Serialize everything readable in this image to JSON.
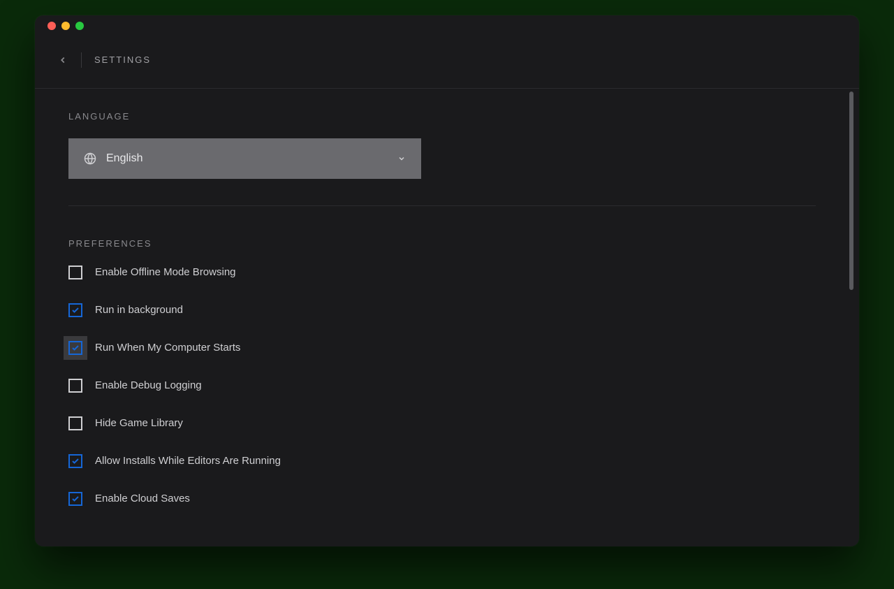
{
  "header": {
    "title": "SETTINGS"
  },
  "language": {
    "section_label": "LANGUAGE",
    "selected": "English"
  },
  "preferences": {
    "section_label": "PREFERENCES",
    "items": [
      {
        "label": "Enable Offline Mode Browsing",
        "checked": false,
        "focused": false
      },
      {
        "label": "Run in background",
        "checked": true,
        "focused": false
      },
      {
        "label": "Run When My Computer Starts",
        "checked": true,
        "focused": true
      },
      {
        "label": "Enable Debug Logging",
        "checked": false,
        "focused": false
      },
      {
        "label": "Hide Game Library",
        "checked": false,
        "focused": false
      },
      {
        "label": "Allow Installs While Editors Are Running",
        "checked": true,
        "focused": false
      },
      {
        "label": "Enable Cloud Saves",
        "checked": true,
        "focused": false
      }
    ]
  }
}
